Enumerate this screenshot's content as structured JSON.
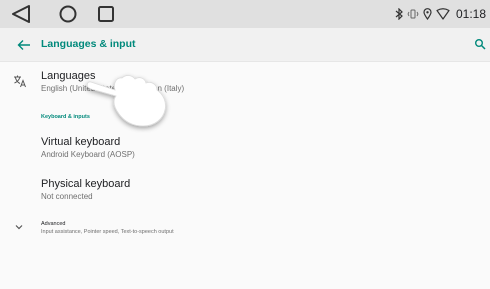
{
  "status_bar": {
    "nav_icons": [
      "back-triangle-icon",
      "home-circle-icon",
      "recents-square-icon"
    ],
    "indicator_icons": [
      "bluetooth-icon",
      "vibrate-icon",
      "location-icon",
      "wifi-icon"
    ],
    "time": "01:18"
  },
  "appbar": {
    "title": "Languages & input",
    "accent_color": "#00897b"
  },
  "languages": {
    "title": "Languages",
    "summary": "English (United States) and Italian (Italy)",
    "icon": "translate-icon"
  },
  "category": "Keyboard & inputs",
  "virtual_keyboard": {
    "title": "Virtual keyboard",
    "summary": "Android Keyboard (AOSP)"
  },
  "physical_keyboard": {
    "title": "Physical keyboard",
    "summary": "Not connected"
  },
  "advanced": {
    "title": "Advanced",
    "summary": "Input assistance, Pointer speed, Text-to-speech output",
    "icon": "chevron-down-icon"
  }
}
